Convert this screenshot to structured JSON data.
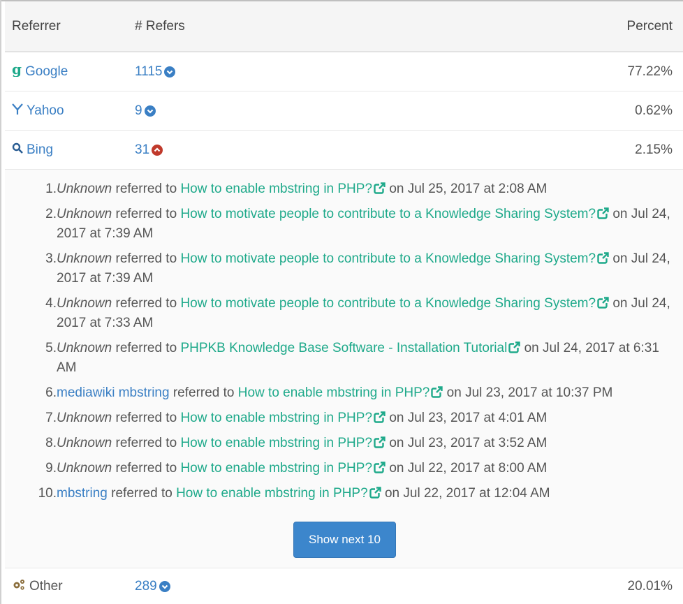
{
  "header": {
    "col1": "Referrer",
    "col2": "# Refers",
    "col3": "Percent"
  },
  "rows": [
    {
      "name": "Google",
      "icon": "google-icon",
      "count": "1115",
      "toggle": "expand",
      "percent": "77.22%"
    },
    {
      "name": "Yahoo",
      "icon": "yahoo-icon",
      "count": "9",
      "toggle": "expand",
      "percent": "0.62%"
    },
    {
      "name": "Bing",
      "icon": "bing-search-icon",
      "count": "31",
      "toggle": "collapse",
      "percent": "2.15%"
    }
  ],
  "referred_to": "referred to",
  "on": "on",
  "bing_refs": [
    {
      "n": "1.",
      "ref": "Unknown",
      "unknown": true,
      "title": "How to enable mbstring in PHP?",
      "date": "Jul 25, 2017 at 2:08 AM"
    },
    {
      "n": "2.",
      "ref": "Unknown",
      "unknown": true,
      "title": "How to motivate people to contribute to a Knowledge Sharing System?",
      "date": "Jul 24, 2017 at 7:39 AM"
    },
    {
      "n": "3.",
      "ref": "Unknown",
      "unknown": true,
      "title": "How to motivate people to contribute to a Knowledge Sharing System?",
      "date": "Jul 24, 2017 at 7:39 AM"
    },
    {
      "n": "4.",
      "ref": "Unknown",
      "unknown": true,
      "title": "How to motivate people to contribute to a Knowledge Sharing System?",
      "date": "Jul 24, 2017 at 7:33 AM"
    },
    {
      "n": "5.",
      "ref": "Unknown",
      "unknown": true,
      "title": "PHPKB Knowledge Base Software - Installation Tutorial",
      "date": "Jul 24, 2017 at 6:31 AM"
    },
    {
      "n": "6.",
      "ref": "mediawiki mbstring",
      "unknown": false,
      "title": "How to enable mbstring in PHP?",
      "date": "Jul 23, 2017 at 10:37 PM"
    },
    {
      "n": "7.",
      "ref": "Unknown",
      "unknown": true,
      "title": "How to enable mbstring in PHP?",
      "date": "Jul 23, 2017 at 4:01 AM"
    },
    {
      "n": "8.",
      "ref": "Unknown",
      "unknown": true,
      "title": "How to enable mbstring in PHP?",
      "date": "Jul 23, 2017 at 3:52 AM"
    },
    {
      "n": "9.",
      "ref": "Unknown",
      "unknown": true,
      "title": "How to enable mbstring in PHP?",
      "date": "Jul 22, 2017 at 8:00 AM"
    },
    {
      "n": "10.",
      "ref": "mbstring",
      "unknown": false,
      "title": "How to enable mbstring in PHP?",
      "date": "Jul 22, 2017 at 12:04 AM"
    }
  ],
  "show_next_label": "Show next 10",
  "other": {
    "name": "Other",
    "icon": "cogs-icon",
    "count": "289",
    "toggle": "expand",
    "percent": "20.01%"
  },
  "colors": {
    "link_blue": "#3a7fc4",
    "link_green": "#1ea98a",
    "collapse_red": "#c0392b",
    "button": "#3c86cc"
  }
}
